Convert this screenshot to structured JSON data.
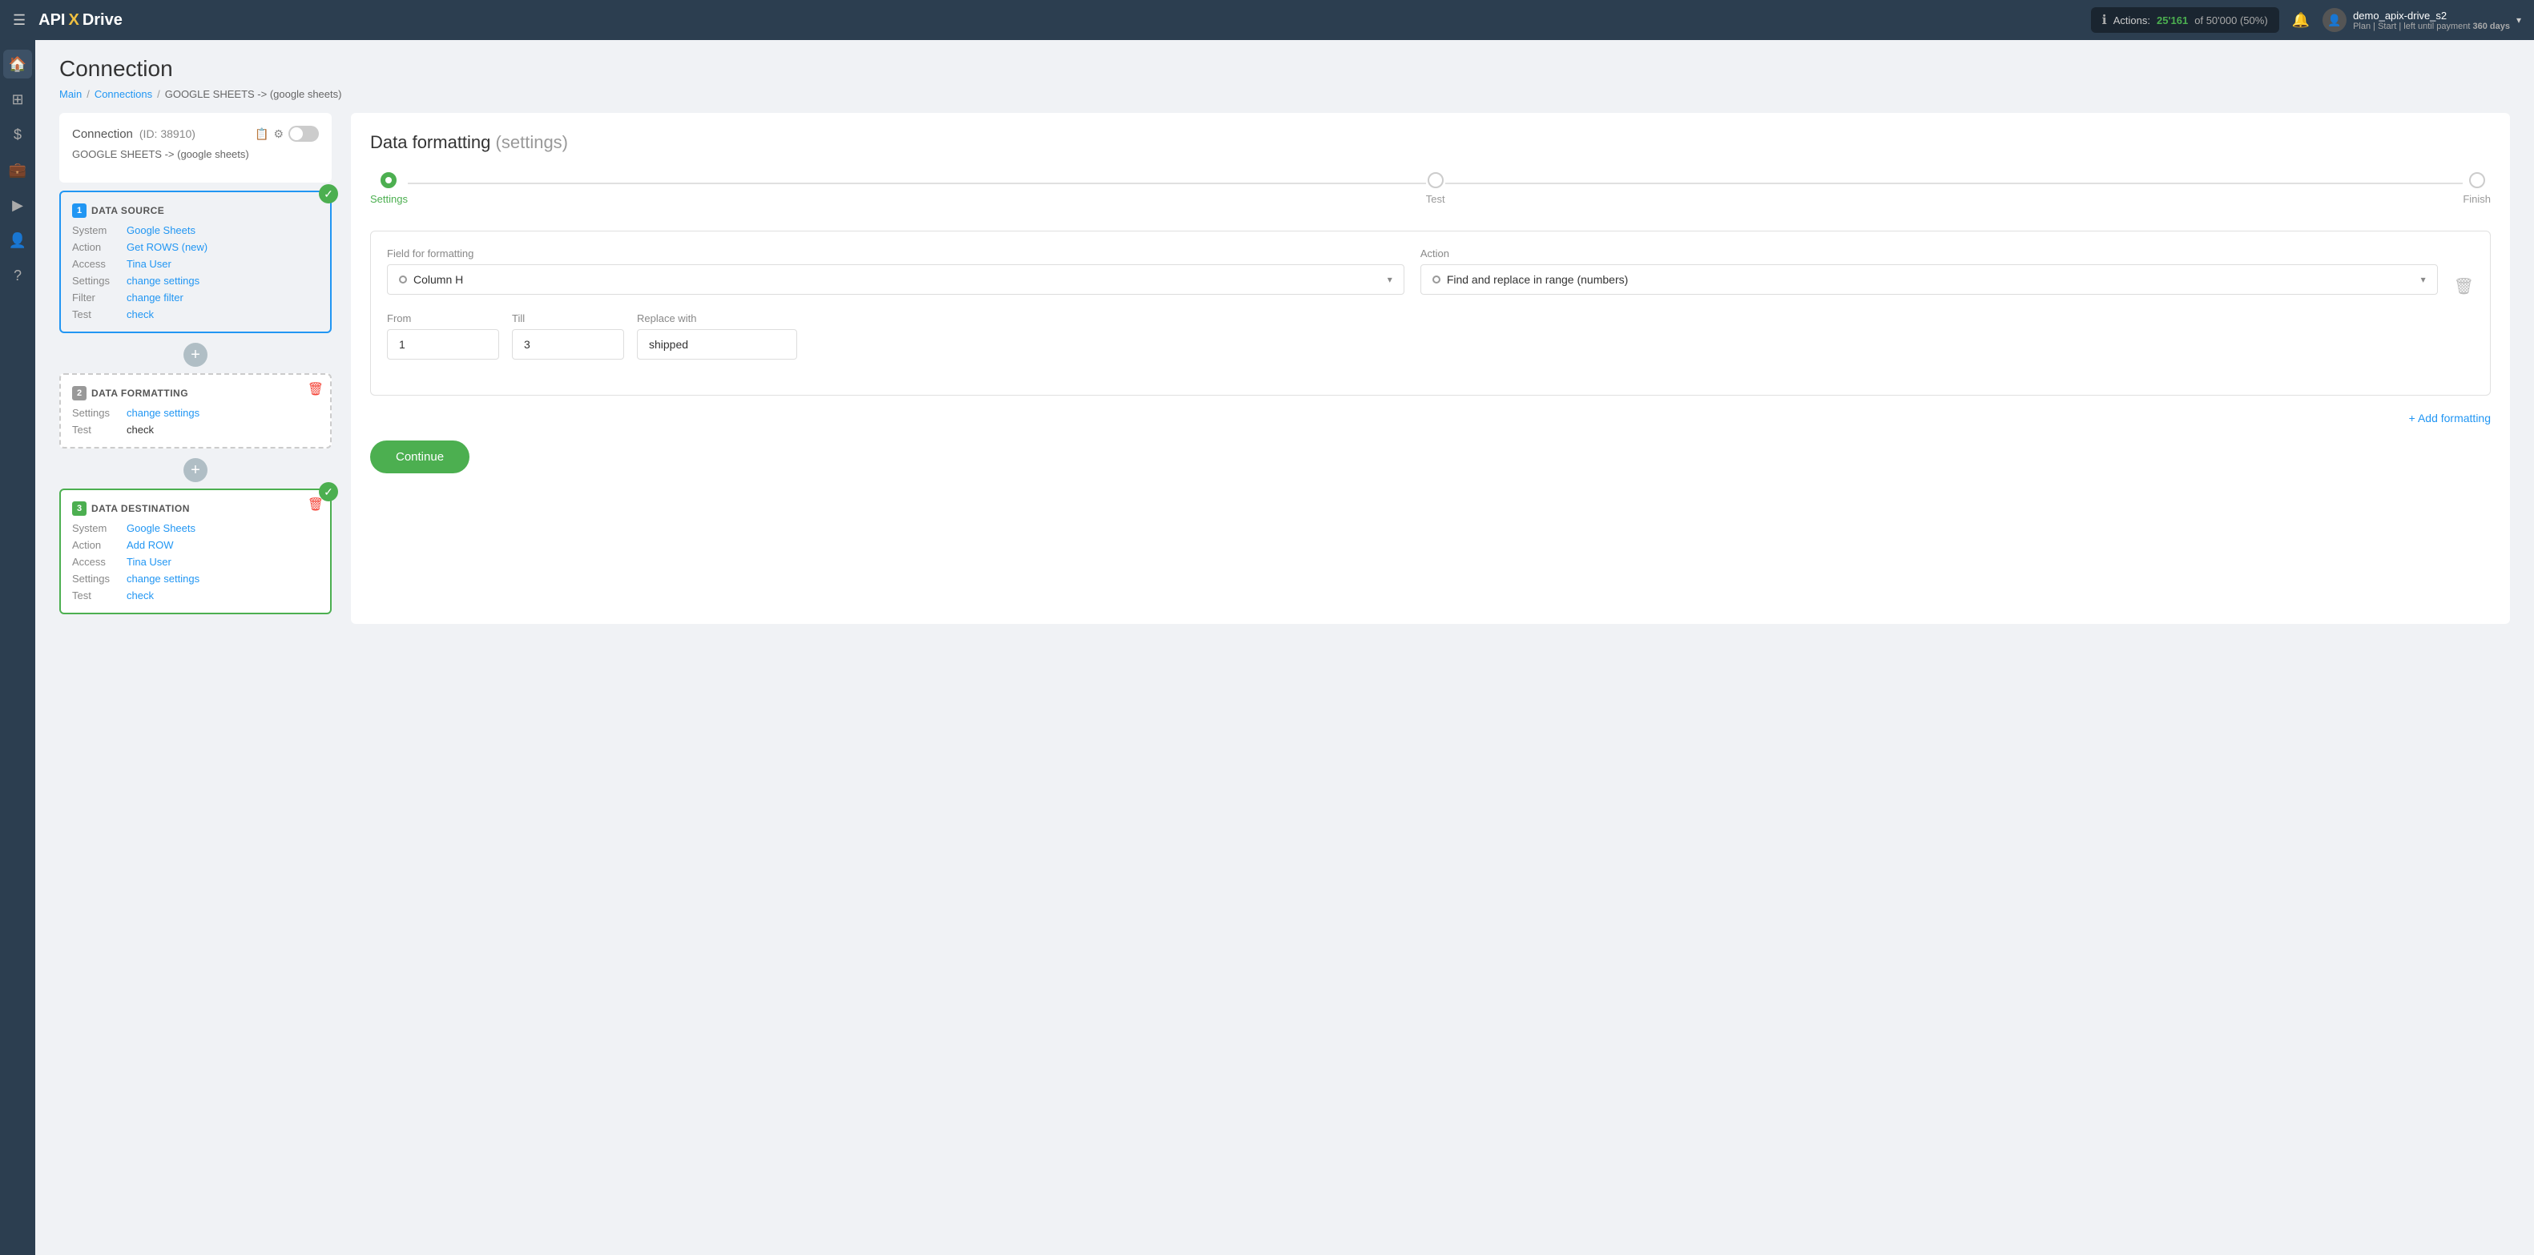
{
  "topnav": {
    "logo": "API",
    "logo_x": "X",
    "logo_drive": "Drive",
    "actions_label": "Actions:",
    "actions_count": "25'161",
    "actions_of": "of",
    "actions_total": "50'000",
    "actions_percent": "(50%)",
    "user_name": "demo_apix-drive_s2",
    "user_plan": "Plan | Start | left until payment",
    "user_days": "360 days"
  },
  "page": {
    "title": "Connection",
    "breadcrumb_main": "Main",
    "breadcrumb_connections": "Connections",
    "breadcrumb_current": "GOOGLE SHEETS -> (google sheets)",
    "connection_title": "Connection",
    "connection_id": "(ID: 38910)",
    "connection_subtitle": "GOOGLE SHEETS -> (google sheets)"
  },
  "left_panel": {
    "block1_title": "DATA SOURCE",
    "block1_num": "1",
    "block1_rows": [
      {
        "label": "System",
        "value": "Google Sheets",
        "is_link": true
      },
      {
        "label": "Action",
        "value": "Get ROWS (new)",
        "is_link": true
      },
      {
        "label": "Access",
        "value": "Tina User",
        "is_link": true
      },
      {
        "label": "Settings",
        "value": "change settings",
        "is_link": true
      },
      {
        "label": "Filter",
        "value": "change filter",
        "is_link": true
      },
      {
        "label": "Test",
        "value": "check",
        "is_link": true
      }
    ],
    "block2_title": "DATA FORMATTING",
    "block2_num": "2",
    "block2_rows": [
      {
        "label": "Settings",
        "value": "change settings",
        "is_link": true
      },
      {
        "label": "Test",
        "value": "check",
        "is_link": false
      }
    ],
    "block3_title": "DATA DESTINATION",
    "block3_num": "3",
    "block3_rows": [
      {
        "label": "System",
        "value": "Google Sheets",
        "is_link": true
      },
      {
        "label": "Action",
        "value": "Add ROW",
        "is_link": true
      },
      {
        "label": "Access",
        "value": "Tina User",
        "is_link": true
      },
      {
        "label": "Settings",
        "value": "change settings",
        "is_link": true
      },
      {
        "label": "Test",
        "value": "check",
        "is_link": true
      }
    ]
  },
  "right_panel": {
    "title": "Data formatting",
    "title_paren": "(settings)",
    "steps": [
      {
        "label": "Settings",
        "active": true
      },
      {
        "label": "Test",
        "active": false
      },
      {
        "label": "Finish",
        "active": false
      }
    ],
    "field_label": "Field for formatting",
    "field_value": "Column H",
    "action_label": "Action",
    "action_value": "Find and replace in range (numbers)",
    "from_label": "From",
    "from_value": "1",
    "till_label": "Till",
    "till_value": "3",
    "replace_label": "Replace with",
    "replace_value": "shipped",
    "add_formatting": "+ Add formatting",
    "continue_label": "Continue"
  }
}
